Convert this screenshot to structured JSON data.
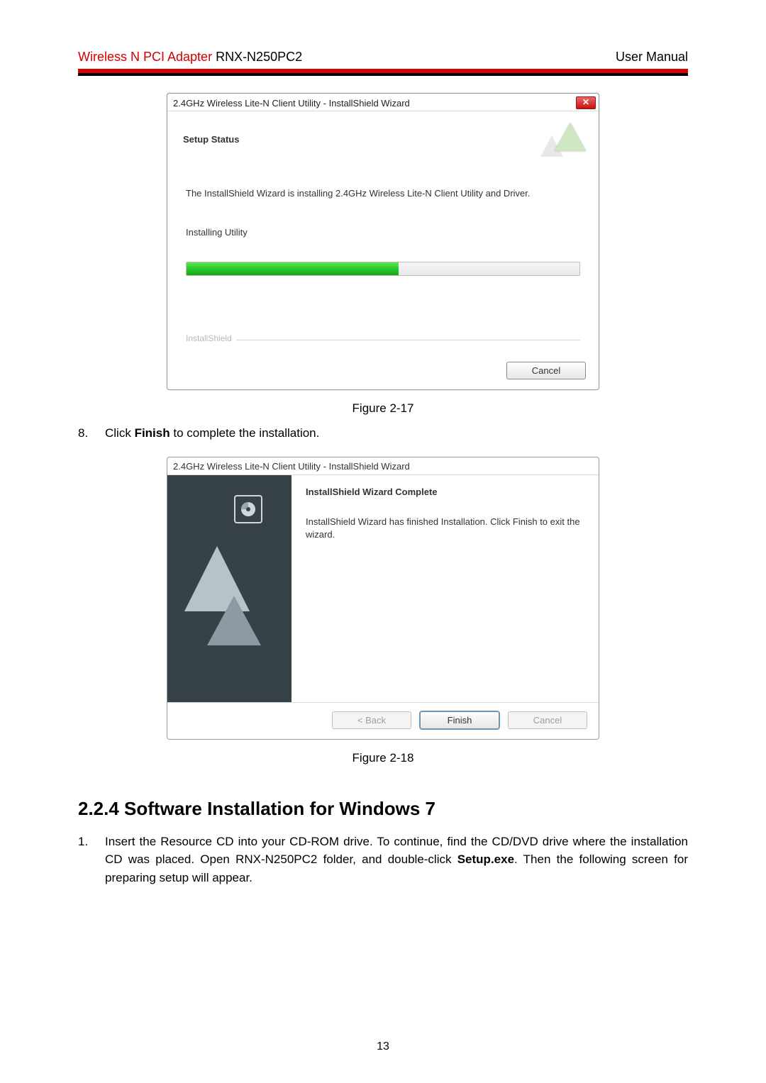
{
  "header": {
    "product_red": "Wireless N PCI Adapter",
    "model": " RNX-N250PC2",
    "right": "User Manual"
  },
  "dialog1": {
    "title": "2.4GHz Wireless Lite-N Client Utility - InstallShield Wizard",
    "close_glyph": "✕",
    "setup_status": "Setup Status",
    "progress_text": "The InstallShield Wizard is installing 2.4GHz Wireless Lite-N Client Utility and Driver.",
    "installing": "Installing Utility",
    "group_label": "InstallShield",
    "cancel": "Cancel",
    "progress_percent": 54
  },
  "caption1": "Figure 2-17",
  "step8": {
    "num": "8.",
    "pre": "Click ",
    "bold": "Finish",
    "post": " to complete the installation."
  },
  "dialog2": {
    "title": "2.4GHz Wireless Lite-N Client Utility - InstallShield Wizard",
    "heading": "InstallShield Wizard Complete",
    "body": "InstallShield Wizard has finished Installation. Click Finish to exit the wizard.",
    "back": "< Back",
    "finish": "Finish",
    "cancel": "Cancel"
  },
  "caption2": "Figure 2-18",
  "section_heading": "2.2.4 Software Installation for Windows 7",
  "step1": {
    "num": "1.",
    "text_pre": "Insert the Resource CD into your CD-ROM drive. To continue, find the CD/DVD drive where the installation CD was placed. Open RNX-N250PC2 folder, and double-click ",
    "bold": "Setup.exe",
    "text_post": ". Then the following screen for preparing setup will appear."
  },
  "page_number": "13"
}
